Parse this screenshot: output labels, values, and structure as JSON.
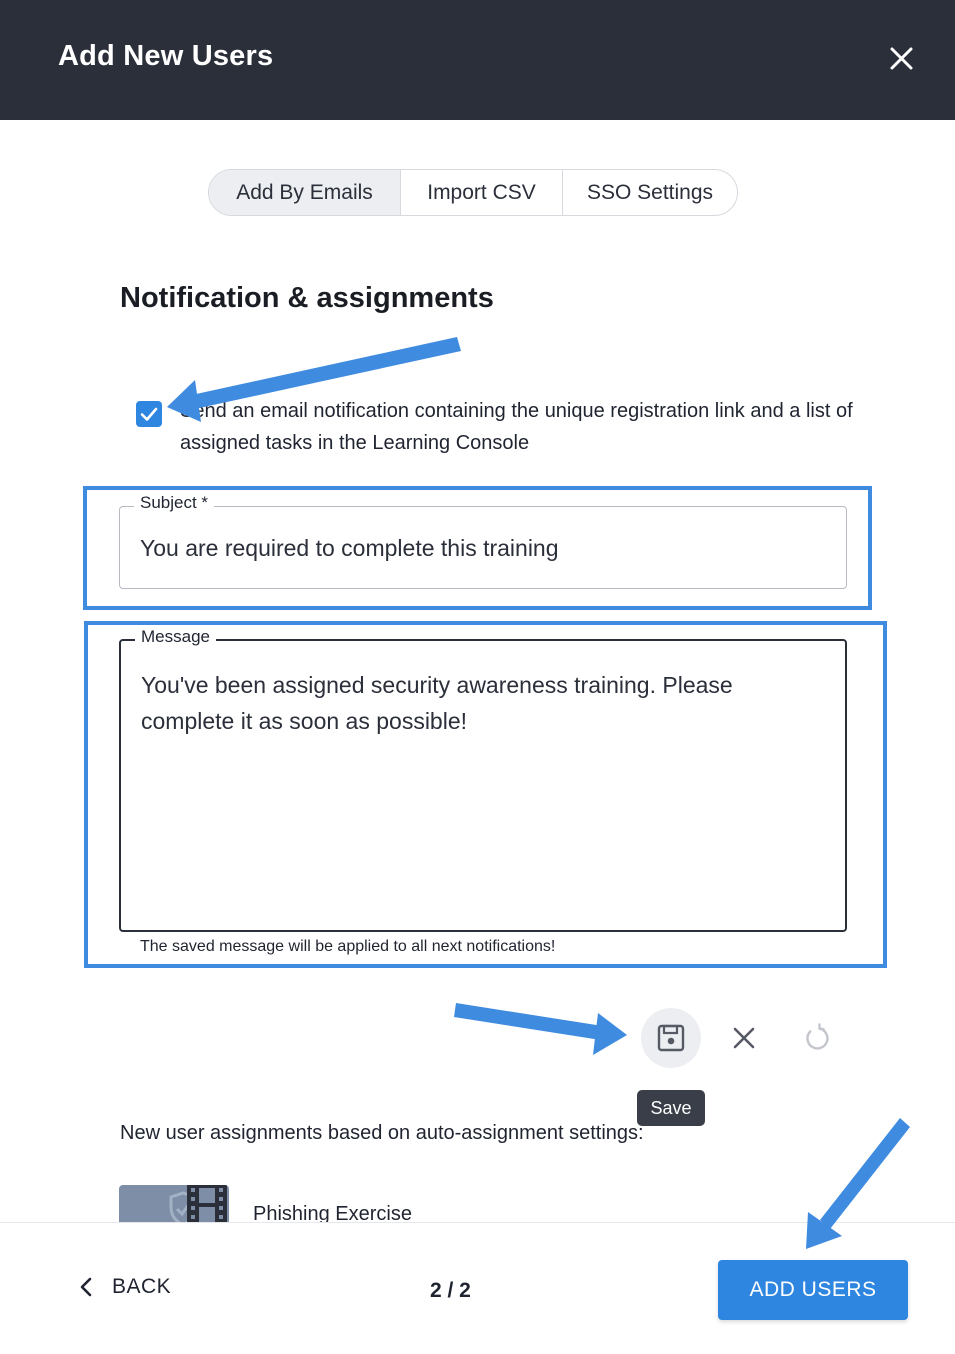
{
  "header": {
    "title": "Add New Users",
    "close_icon": "close-icon"
  },
  "tabs": [
    {
      "label": "Add By Emails",
      "active": true
    },
    {
      "label": "Import CSV",
      "active": false
    },
    {
      "label": "SSO Settings",
      "active": false
    }
  ],
  "section": {
    "title": "Notification & assignments"
  },
  "notification": {
    "checked": true,
    "label": "Send an email notification containing the unique registration link and a list of assigned tasks in the Learning Console"
  },
  "subject": {
    "label": "Subject *",
    "value": "You are required to complete this training"
  },
  "message": {
    "label": "Message",
    "value": "You've been assigned security awareness training. Please complete it as soon as possible!",
    "helper": "The saved message will be applied to all next notifications!"
  },
  "actions": {
    "save_tooltip": "Save"
  },
  "assignments": {
    "heading": "New user assignments based on auto-assignment settings:",
    "items": [
      {
        "name": "Phishing Exercise"
      }
    ]
  },
  "footer": {
    "back_label": "BACK",
    "pager": "2 / 2",
    "add_users_label": "ADD USERS"
  },
  "colors": {
    "header_bg": "#2b2f3a",
    "accent": "#2f86e0",
    "annotation": "#3f8be0"
  }
}
